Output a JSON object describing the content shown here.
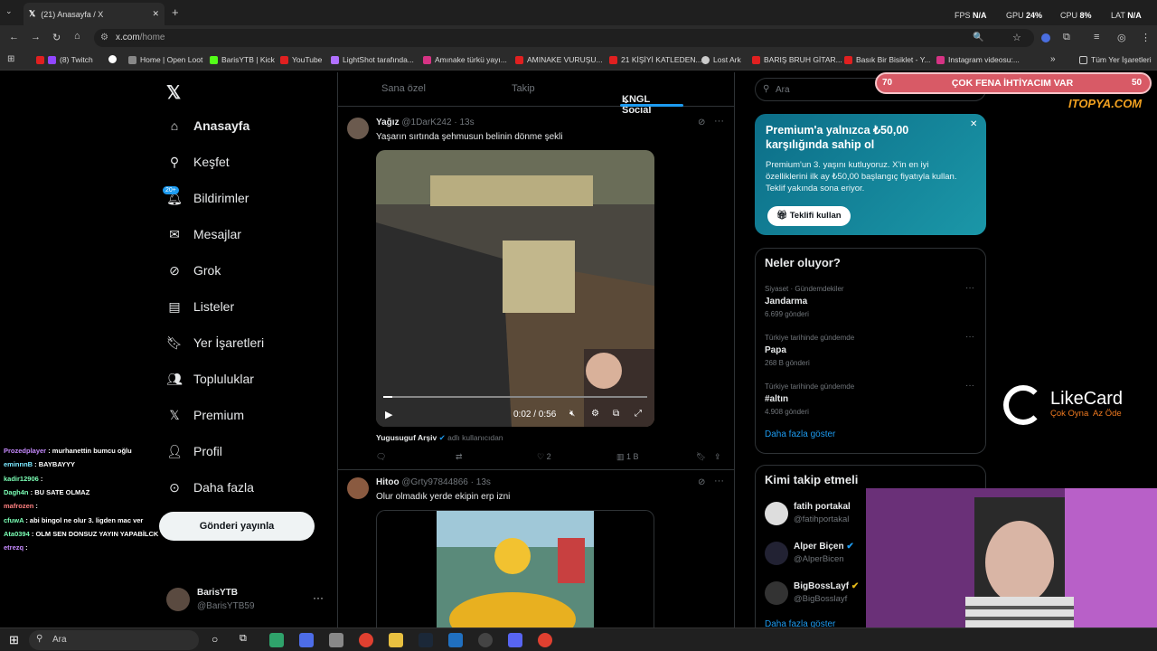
{
  "browser": {
    "tab_title": "(21) Anasayfa / X",
    "url_host": "x.com",
    "url_path": "/home",
    "bookmarks": [
      "(8) Twitch",
      "Home | Open Loot",
      "BarisYTB | Kick",
      "YouTube",
      "LightShot tarafında...",
      "Amınake türkü yayı...",
      "AMINAKE VURUŞU...",
      "21 KİŞİYİ KATLEDEN...",
      "Lost Ark",
      "BARIŞ BRUH GİTAR...",
      "Basık Bir Bisiklet - Y...",
      "Instagram videosu:..."
    ],
    "all_bookmarks": "Tüm Yer İşaretleri"
  },
  "hud": {
    "fps_label": "FPS",
    "fps_value": "N/A",
    "gpu_label": "GPU",
    "gpu_value": "24%",
    "cpu_label": "CPU",
    "cpu_value": "8%",
    "lat_label": "LAT",
    "lat_value": "N/A"
  },
  "nav": {
    "items": [
      "Anasayfa",
      "Keşfet",
      "Bildirimler",
      "Mesajlar",
      "Grok",
      "Listeler",
      "Yer İşaretleri",
      "Topluluklar",
      "Premium",
      "Profil",
      "Daha fazla"
    ],
    "notif_badge": "20+",
    "post_button": "Gönderi yayınla",
    "account_name": "BarisYTB",
    "account_handle": "@BarisYTB59"
  },
  "feed": {
    "tabs": [
      "Sana özel",
      "Takip",
      "KNGL Social"
    ],
    "tweets": [
      {
        "name": "Yağız",
        "handle": "@1DarK242",
        "time": "13s",
        "text": "Yaşarın sırtında şehmusun belinin dönme şekli",
        "video_time": "0:02 / 0:56",
        "source_name": "Yugusuguf Arşiv",
        "source_note": "adlı kullanıcıdan",
        "likes": "2",
        "views": "1 B"
      },
      {
        "name": "Hitoo",
        "handle": "@Grty97844866",
        "time": "13s",
        "text": "Olur olmadık yerde ekipin erp izni"
      }
    ]
  },
  "sidebar": {
    "search_placeholder": "Ara",
    "premium": {
      "title": "Premium'a yalnızca ₺50,00 karşılığında sahip ol",
      "body": "Premium'un 3. yaşını kutluyoruz. X'in en iyi özelliklerini ilk ay ₺50,00 başlangıç fiyatıyla kullan. Teklif yakında sona eriyor.",
      "button": "Teklifi kullan"
    },
    "trends_title": "Neler oluyor?",
    "trends": [
      {
        "context": "Siyaset · Gündemdekiler",
        "topic": "Jandarma",
        "count": "6.699 gönderi"
      },
      {
        "context": "Türkiye tarihinde gündemde",
        "topic": "Papa",
        "count": "268 B gönderi"
      },
      {
        "context": "Türkiye tarihinde gündemde",
        "topic": "#altın",
        "count": "4.908 gönderi"
      }
    ],
    "show_more": "Daha fazla göster",
    "follow_title": "Kimi takip etmeli",
    "follow": [
      {
        "name": "fatih portakal",
        "handle": "@fatihportakal"
      },
      {
        "name": "Alper Biçen",
        "handle": "@AlperBicen"
      },
      {
        "name": "BigBossLayf",
        "handle": "@BigBosslayf"
      }
    ],
    "follow_more": "Daha fazla göster"
  },
  "overlay": {
    "bar_left": "70",
    "bar_text": "ÇOK FENA İHTİYACIM VAR",
    "bar_right": "50",
    "watermark": "ITOPYA.COM",
    "likecard_name": "LikeCard",
    "likecard_slogan": "Çok Oyna  Az Öde",
    "chat": [
      {
        "user": "Prozedplayer",
        "msg": "murhanettin bumcu oğlu",
        "color": "#c78bff"
      },
      {
        "user": "eminnnB",
        "msg": "BAYBAYYY",
        "color": "#7be8ff"
      },
      {
        "user": "kadir12906",
        "msg": "",
        "color": "#7bffb5"
      },
      {
        "user": "Dagh4n",
        "msg": "BU SATE OLMAZ",
        "color": "#7bffb5"
      },
      {
        "user": "mafrozen",
        "msg": "",
        "color": "#ff8080"
      },
      {
        "user": "cfuwA",
        "msg": "abi bingol ne olur 3. ligden mac ver",
        "color": "#7bffb5"
      },
      {
        "user": "Ata0394",
        "msg": "OLM SEN DONSUZ YAYIN YAPABİLCK",
        "color": "#7bffb5"
      },
      {
        "user": "etrezq",
        "msg": "",
        "color": "#c78bff"
      }
    ]
  },
  "taskbar": {
    "search_placeholder": "Ara"
  }
}
